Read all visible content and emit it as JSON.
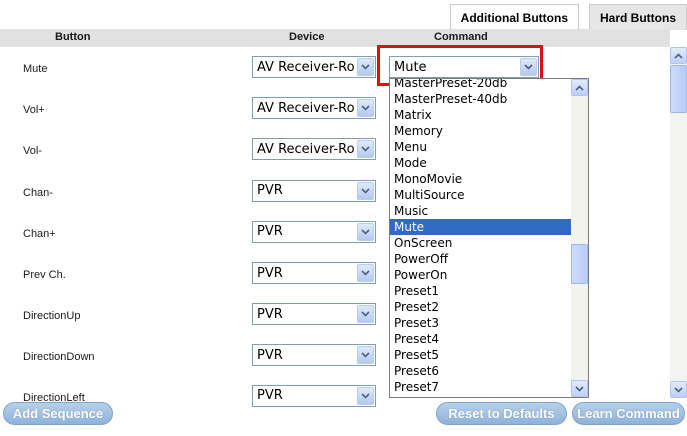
{
  "tabs": [
    {
      "label": "Additional Buttons",
      "active": false
    },
    {
      "label": "Hard Buttons",
      "active": true
    }
  ],
  "columns": {
    "button": "Button",
    "device": "Device",
    "command": "Command"
  },
  "rows": [
    {
      "button": "Mute",
      "device": "AV Receiver-Ro"
    },
    {
      "button": "Vol+",
      "device": "AV Receiver-Ro"
    },
    {
      "button": "Vol-",
      "device": "AV Receiver-Ro"
    },
    {
      "button": "Chan-",
      "device": "PVR"
    },
    {
      "button": "Chan+",
      "device": "PVR"
    },
    {
      "button": "Prev Ch.",
      "device": "PVR"
    },
    {
      "button": "DirectionUp",
      "device": "PVR"
    },
    {
      "button": "DirectionDown",
      "device": "PVR"
    },
    {
      "button": "DirectionLeft",
      "device": "PVR"
    }
  ],
  "command_select": {
    "value": "Mute"
  },
  "dropdown": {
    "items": [
      "MasterPreset-20db",
      "MasterPreset-40db",
      "Matrix",
      "Memory",
      "Menu",
      "Mode",
      "MonoMovie",
      "MultiSource",
      "Music",
      "Mute",
      "OnScreen",
      "PowerOff",
      "PowerOn",
      "Preset1",
      "Preset2",
      "Preset3",
      "Preset4",
      "Preset5",
      "Preset6",
      "Preset7"
    ],
    "selected": "Mute"
  },
  "footer": {
    "add_sequence": "Add Sequence",
    "reset_defaults": "Reset to Defaults",
    "learn_command": "Learn Command"
  },
  "colors": {
    "highlight": "#e01010",
    "selection": "#316ac5",
    "button": "#9dbde2"
  },
  "icons": {
    "select_arrow": "chevron-down-icon",
    "scroll_up": "chevron-up-icon"
  }
}
